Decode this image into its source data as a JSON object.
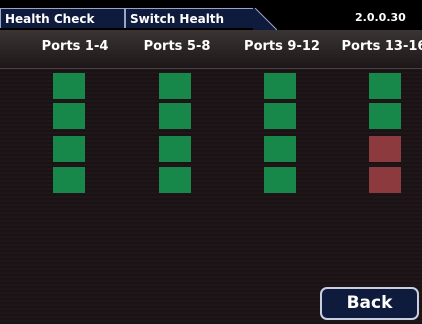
{
  "tabs": [
    {
      "label": "Health Check"
    },
    {
      "label": "Switch Health"
    }
  ],
  "version": "2.0.0.30",
  "columns": [
    {
      "label": "Ports 1-4",
      "ports": [
        "ok",
        "ok",
        "ok",
        "ok"
      ]
    },
    {
      "label": "Ports 5-8",
      "ports": [
        "ok",
        "ok",
        "ok",
        "ok"
      ]
    },
    {
      "label": "Ports 9-12",
      "ports": [
        "ok",
        "ok",
        "ok",
        "ok"
      ]
    },
    {
      "label": "Ports 13-16",
      "ports": [
        "ok",
        "ok",
        "fault",
        "fault"
      ]
    }
  ],
  "status_colors": {
    "ok": "#17874a",
    "fault": "#8c3a3d"
  },
  "back_label": "Back"
}
